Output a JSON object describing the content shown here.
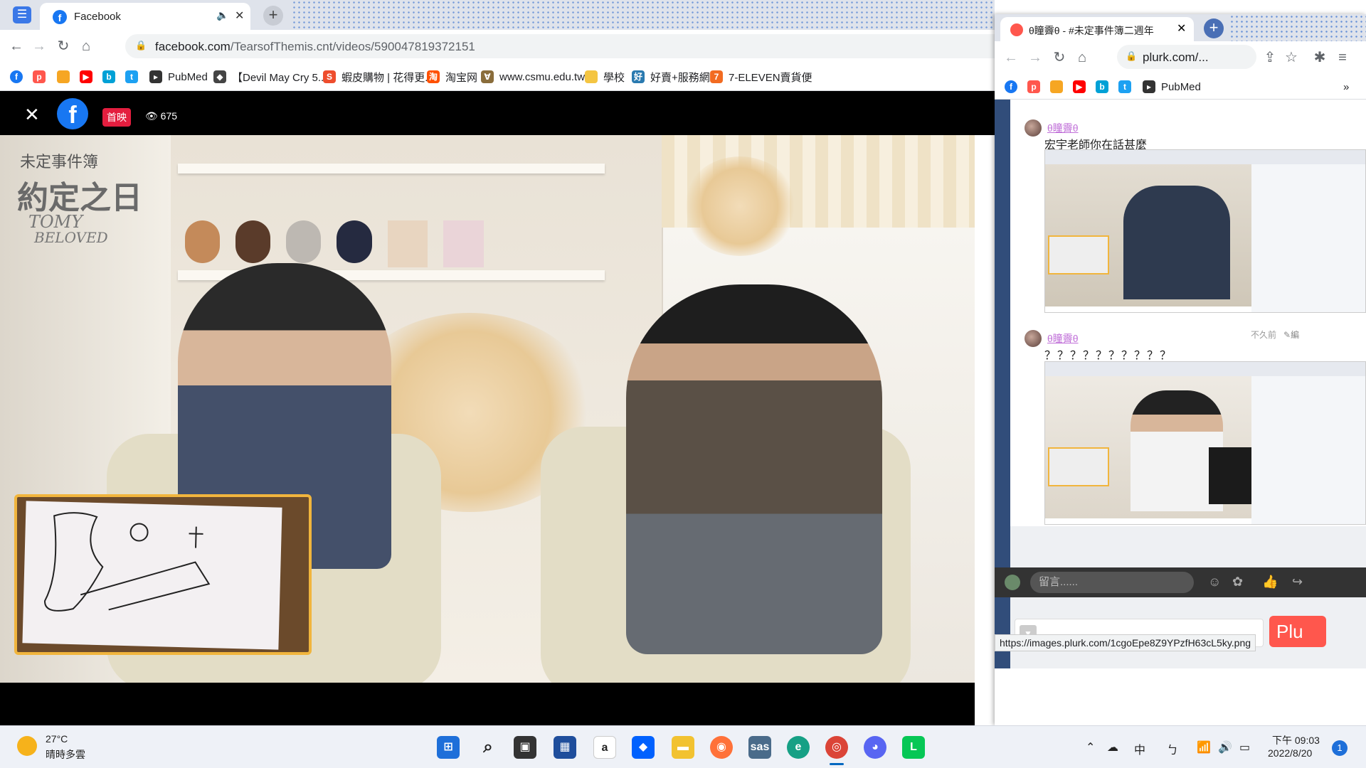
{
  "left_browser": {
    "tab_title": "Facebook",
    "url_domain": "facebook.com",
    "url_path": "/TearsofThemis.cnt/videos/590047819372151",
    "bookmarks": [
      {
        "label": "",
        "icon": "facebook-icon",
        "color": "#1877f2"
      },
      {
        "label": "",
        "icon": "plurk-icon",
        "color": "#ff574d"
      },
      {
        "label": "",
        "icon": "rss-icon",
        "color": "#f6a623"
      },
      {
        "label": "",
        "icon": "youtube-icon",
        "color": "#ff0000"
      },
      {
        "label": "",
        "icon": "bilibili-icon",
        "color": "#00a1d6"
      },
      {
        "label": "",
        "icon": "twitter-icon",
        "color": "#1da1f2"
      },
      {
        "label": "PubMed",
        "icon": "pubmed-icon",
        "color": "#333333"
      },
      {
        "label": "【Devil May Cry 5...",
        "icon": "dmc-icon",
        "color": "#444444"
      },
      {
        "label": "蝦皮購物 | 花得更...",
        "icon": "shopee-icon",
        "color": "#ee4d2d"
      },
      {
        "label": "淘宝网",
        "icon": "taobao-icon",
        "color": "#ff5000"
      },
      {
        "label": "www.csmu.edu.tw",
        "icon": "csmu-icon",
        "color": "#8a6d3b"
      },
      {
        "label": "學校",
        "icon": "folder-icon",
        "color": "#f4c542"
      },
      {
        "label": "好賣+服務網",
        "icon": "haomai-icon",
        "color": "#2a7ab0"
      },
      {
        "label": "7-ELEVEN賣貨便",
        "icon": "seven-icon",
        "color": "#f26b21"
      }
    ],
    "viewer": {
      "live_badge": "首映",
      "view_count": "675",
      "watermark_title": "未定事件簿",
      "watermark_main": "約定之日",
      "watermark_en1": "TOMY",
      "watermark_en2": "BELOVED"
    }
  },
  "right_browser": {
    "tab_title": "θ瞳霽θ - #未定事件簿二週年",
    "url": "plurk.com/...",
    "bookmark_label": "PubMed",
    "posts": [
      {
        "author": "θ瞳霽θ",
        "text": "宏宇老師你在話甚麼",
        "time": ""
      },
      {
        "author": "θ瞳霽θ",
        "text": "？？？？？？？？？？",
        "time": "不久前"
      }
    ],
    "edit_label": "編",
    "plurk_button": "Plu",
    "status_url": "https://images.plurk.com/1cgoEpe8Z9YPzfH63cL5ky.png",
    "comment_placeholder": "留言......"
  },
  "taskbar": {
    "temperature": "27°C",
    "weather": "晴時多雲",
    "ime_mode": "中",
    "ime_phonetic": "ㄅ",
    "time": "下午 09:03",
    "date": "2022/8/20",
    "notifications": "1"
  }
}
